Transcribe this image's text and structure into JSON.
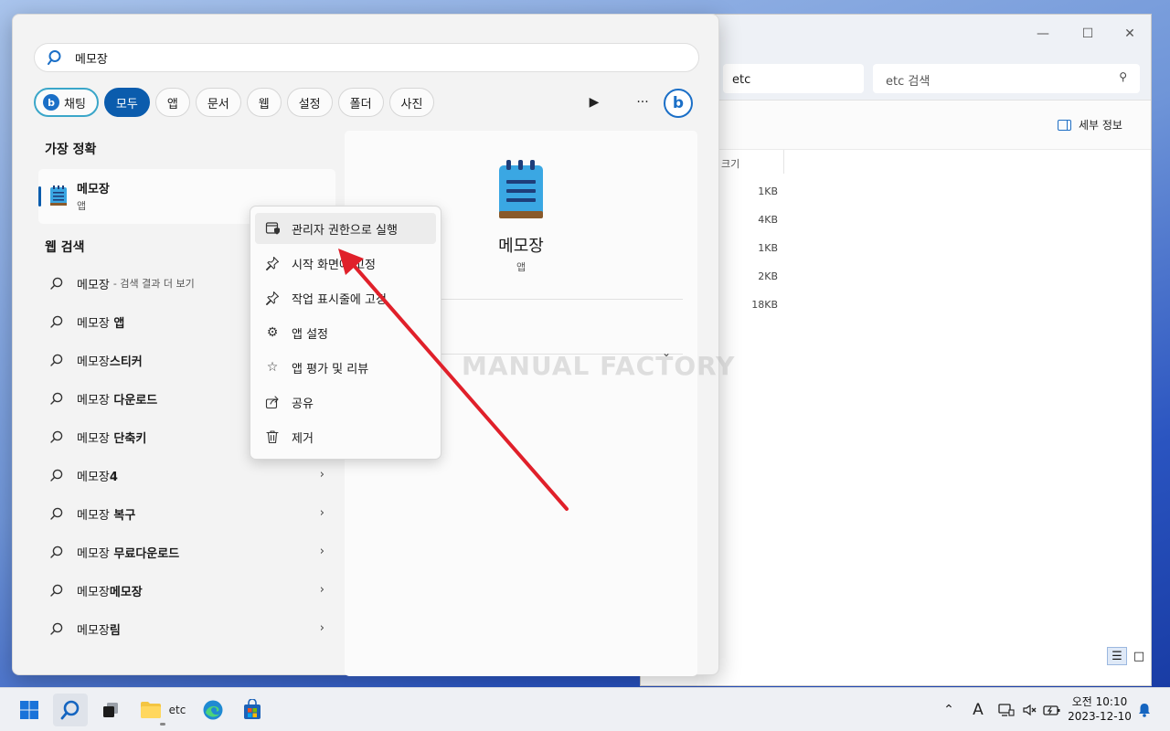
{
  "explorer": {
    "address": "etc",
    "search_placeholder": "etc 검색",
    "details_label": "세부 정보",
    "column_size": "크기",
    "sizes": [
      "1KB",
      "4KB",
      "1KB",
      "2KB",
      "18KB"
    ]
  },
  "search": {
    "query": "메모장",
    "filters": [
      "채팅",
      "모두",
      "앱",
      "문서",
      "웹",
      "설정",
      "폴더",
      "사진"
    ],
    "active_filter": "모두",
    "best_match_title": "가장 정확",
    "best_match": {
      "name": "메모장",
      "type": "앱"
    },
    "web_title": "웹 검색",
    "web_items": [
      {
        "prefix": "메모장",
        "suffix": "",
        "hint": "- 검색 결과 더 보기",
        "chevron": false
      },
      {
        "prefix": "메모장",
        "suffix": " 앱",
        "hint": "",
        "chevron": false
      },
      {
        "prefix": "메모장",
        "suffix": "스티커",
        "hint": "",
        "chevron": false
      },
      {
        "prefix": "메모장",
        "suffix": " 다운로드",
        "hint": "",
        "chevron": false
      },
      {
        "prefix": "메모장",
        "suffix": " 단축키",
        "hint": "",
        "chevron": false
      },
      {
        "prefix": "메모장",
        "suffix": "4",
        "hint": "",
        "chevron": true
      },
      {
        "prefix": "메모장",
        "suffix": " 복구",
        "hint": "",
        "chevron": true
      },
      {
        "prefix": "메모장",
        "suffix": " 무료다운로드",
        "hint": "",
        "chevron": true
      },
      {
        "prefix": "메모장",
        "suffix": "메모장",
        "hint": "",
        "chevron": true
      },
      {
        "prefix": "메모장",
        "suffix": "림",
        "hint": "",
        "chevron": true
      }
    ],
    "preview": {
      "name": "메모장",
      "type": "앱"
    }
  },
  "context_menu": [
    {
      "label": "관리자 권한으로 실행",
      "icon": "shield-window-icon"
    },
    {
      "label": "시작 화면에 고정",
      "icon": "pin-icon"
    },
    {
      "label": "작업 표시줄에 고정",
      "icon": "pin-icon"
    },
    {
      "label": "앱 설정",
      "icon": "gear-icon"
    },
    {
      "label": "앱 평가 및 리뷰",
      "icon": "star-icon"
    },
    {
      "label": "공유",
      "icon": "share-icon"
    },
    {
      "label": "제거",
      "icon": "trash-icon"
    }
  ],
  "watermark": "MANUAL FACTORY",
  "taskbar": {
    "explorer_label": "etc",
    "clock_time": "오전 10:10",
    "clock_date": "2023-12-10"
  },
  "colors": {
    "accent": "#0b5cad",
    "arrow": "#e0202a"
  }
}
